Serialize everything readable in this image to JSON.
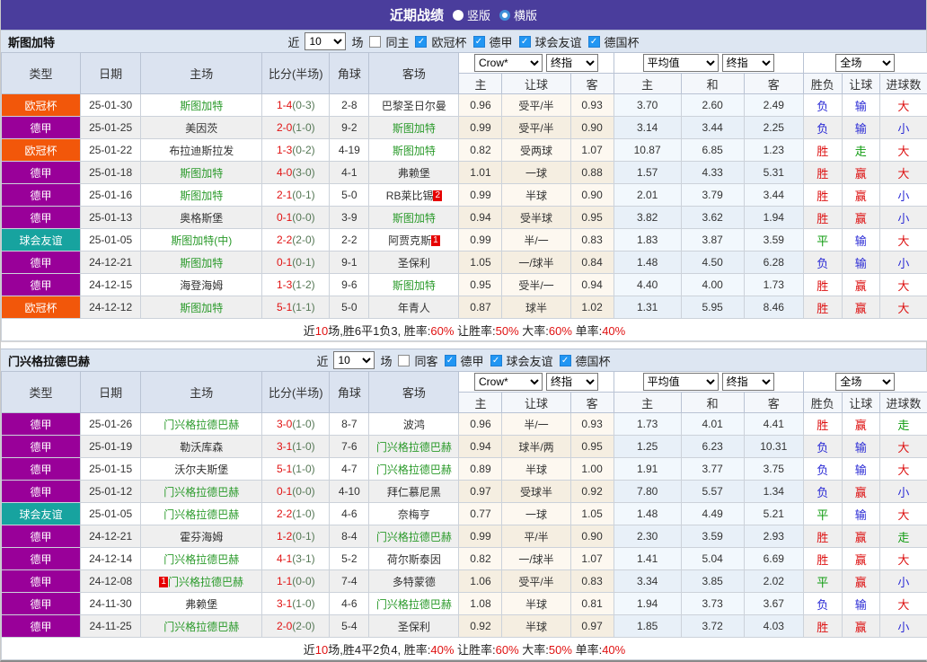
{
  "topbar": {
    "title": "近期战绩",
    "radios": [
      {
        "label": "竖版",
        "selected": true
      },
      {
        "label": "横版",
        "selected": false
      }
    ]
  },
  "table_header": {
    "type": "类型",
    "date": "日期",
    "home": "主场",
    "score": "比分(半场)",
    "corner": "角球",
    "away": "客场",
    "crow_select": "Crow*",
    "crow_final_select": "终指",
    "avg_select": "平均值",
    "avg_final_select": "终指",
    "full_select": "全场",
    "crow_sub": [
      "主",
      "让球",
      "客"
    ],
    "avg_sub": [
      "主",
      "和",
      "客"
    ],
    "result_sub": [
      "胜负",
      "让球",
      "进球数"
    ]
  },
  "type_colors": {
    "欧冠杯": "#f2570a",
    "德甲": "#990099",
    "球会友谊": "#17a39f"
  },
  "result_colors": {
    "胜": "#dd1111",
    "赢": "#dd1111",
    "大": "#dd1111",
    "平": "#0f9b0f",
    "走": "#0f9b0f",
    "负": "#2b2bd5",
    "输": "#2b2bd5",
    "小": "#2b2bd5"
  },
  "sections": [
    {
      "team": "斯图加特",
      "filter": {
        "near": "近",
        "count": "10",
        "games": "场",
        "same_label": "同主",
        "same_checked": false,
        "competitions": [
          "欧冠杯",
          "德甲",
          "球会友谊",
          "德国杯"
        ]
      },
      "rows": [
        {
          "type": "欧冠杯",
          "date": "25-01-30",
          "home": "斯图加特",
          "home_hl": true,
          "score": "1-4",
          "half": "(0-3)",
          "corner": "2-8",
          "away": "巴黎圣日尔曼",
          "away_hl": false,
          "crow": [
            "0.96",
            "受平/半",
            "0.93"
          ],
          "avg": [
            "3.70",
            "2.60",
            "2.49"
          ],
          "res": [
            "负",
            "输",
            "大"
          ]
        },
        {
          "type": "德甲",
          "date": "25-01-25",
          "home": "美因茨",
          "home_hl": false,
          "score": "2-0",
          "half": "(1-0)",
          "corner": "9-2",
          "away": "斯图加特",
          "away_hl": true,
          "crow": [
            "0.99",
            "受平/半",
            "0.90"
          ],
          "avg": [
            "3.14",
            "3.44",
            "2.25"
          ],
          "res": [
            "负",
            "输",
            "小"
          ]
        },
        {
          "type": "欧冠杯",
          "date": "25-01-22",
          "home": "布拉迪斯拉发",
          "home_hl": false,
          "score": "1-3",
          "half": "(0-2)",
          "corner": "4-19",
          "away": "斯图加特",
          "away_hl": true,
          "crow": [
            "0.82",
            "受两球",
            "1.07"
          ],
          "avg": [
            "10.87",
            "6.85",
            "1.23"
          ],
          "res": [
            "胜",
            "走",
            "大"
          ]
        },
        {
          "type": "德甲",
          "date": "25-01-18",
          "home": "斯图加特",
          "home_hl": true,
          "score": "4-0",
          "half": "(3-0)",
          "corner": "4-1",
          "away": "弗赖堡",
          "away_hl": false,
          "crow": [
            "1.01",
            "一球",
            "0.88"
          ],
          "avg": [
            "1.57",
            "4.33",
            "5.31"
          ],
          "res": [
            "胜",
            "赢",
            "大"
          ]
        },
        {
          "type": "德甲",
          "date": "25-01-16",
          "home": "斯图加特",
          "home_hl": true,
          "score": "2-1",
          "half": "(0-1)",
          "corner": "5-0",
          "away": "RB莱比锡",
          "away_hl": false,
          "away_badge": "2",
          "crow": [
            "0.99",
            "半球",
            "0.90"
          ],
          "avg": [
            "2.01",
            "3.79",
            "3.44"
          ],
          "res": [
            "胜",
            "赢",
            "小"
          ]
        },
        {
          "type": "德甲",
          "date": "25-01-13",
          "home": "奥格斯堡",
          "home_hl": false,
          "score": "0-1",
          "half": "(0-0)",
          "corner": "3-9",
          "away": "斯图加特",
          "away_hl": true,
          "crow": [
            "0.94",
            "受半球",
            "0.95"
          ],
          "avg": [
            "3.82",
            "3.62",
            "1.94"
          ],
          "res": [
            "胜",
            "赢",
            "小"
          ]
        },
        {
          "type": "球会友谊",
          "date": "25-01-05",
          "home": "斯图加特(中)",
          "home_hl": true,
          "score": "2-2",
          "half": "(2-0)",
          "corner": "2-2",
          "away": "阿贾克斯",
          "away_hl": false,
          "away_badge": "1",
          "crow": [
            "0.99",
            "半/一",
            "0.83"
          ],
          "avg": [
            "1.83",
            "3.87",
            "3.59"
          ],
          "res": [
            "平",
            "输",
            "大"
          ]
        },
        {
          "type": "德甲",
          "date": "24-12-21",
          "home": "斯图加特",
          "home_hl": true,
          "score": "0-1",
          "half": "(0-1)",
          "corner": "9-1",
          "away": "圣保利",
          "away_hl": false,
          "crow": [
            "1.05",
            "一/球半",
            "0.84"
          ],
          "avg": [
            "1.48",
            "4.50",
            "6.28"
          ],
          "res": [
            "负",
            "输",
            "小"
          ]
        },
        {
          "type": "德甲",
          "date": "24-12-15",
          "home": "海登海姆",
          "home_hl": false,
          "score": "1-3",
          "half": "(1-2)",
          "corner": "9-6",
          "away": "斯图加特",
          "away_hl": true,
          "crow": [
            "0.95",
            "受半/一",
            "0.94"
          ],
          "avg": [
            "4.40",
            "4.00",
            "1.73"
          ],
          "res": [
            "胜",
            "赢",
            "大"
          ]
        },
        {
          "type": "欧冠杯",
          "date": "24-12-12",
          "home": "斯图加特",
          "home_hl": true,
          "score": "5-1",
          "half": "(1-1)",
          "corner": "5-0",
          "away": "年青人",
          "away_hl": false,
          "crow": [
            "0.87",
            "球半",
            "1.02"
          ],
          "avg": [
            "1.31",
            "5.95",
            "8.46"
          ],
          "res": [
            "胜",
            "赢",
            "大"
          ]
        }
      ],
      "summary": [
        {
          "t": "近"
        },
        {
          "t": "10",
          "red": true
        },
        {
          "t": "场,胜6平1负3, 胜率:"
        },
        {
          "t": "60%",
          "red": true
        },
        {
          "t": " 让胜率:"
        },
        {
          "t": "50%",
          "red": true
        },
        {
          "t": " 大率:"
        },
        {
          "t": "60%",
          "red": true
        },
        {
          "t": " 单率:"
        },
        {
          "t": "40%",
          "red": true
        }
      ]
    },
    {
      "team": "门兴格拉德巴赫",
      "filter": {
        "near": "近",
        "count": "10",
        "games": "场",
        "same_label": "同客",
        "same_checked": false,
        "competitions": [
          "德甲",
          "球会友谊",
          "德国杯"
        ]
      },
      "rows": [
        {
          "type": "德甲",
          "date": "25-01-26",
          "home": "门兴格拉德巴赫",
          "home_hl": true,
          "score": "3-0",
          "half": "(1-0)",
          "corner": "8-7",
          "away": "波鸿",
          "away_hl": false,
          "crow": [
            "0.96",
            "半/一",
            "0.93"
          ],
          "avg": [
            "1.73",
            "4.01",
            "4.41"
          ],
          "res": [
            "胜",
            "赢",
            "走"
          ]
        },
        {
          "type": "德甲",
          "date": "25-01-19",
          "home": "勒沃库森",
          "home_hl": false,
          "score": "3-1",
          "half": "(1-0)",
          "corner": "7-6",
          "away": "门兴格拉德巴赫",
          "away_hl": true,
          "crow": [
            "0.94",
            "球半/两",
            "0.95"
          ],
          "avg": [
            "1.25",
            "6.23",
            "10.31"
          ],
          "res": [
            "负",
            "输",
            "大"
          ]
        },
        {
          "type": "德甲",
          "date": "25-01-15",
          "home": "沃尔夫斯堡",
          "home_hl": false,
          "score": "5-1",
          "half": "(1-0)",
          "corner": "4-7",
          "away": "门兴格拉德巴赫",
          "away_hl": true,
          "crow": [
            "0.89",
            "半球",
            "1.00"
          ],
          "avg": [
            "1.91",
            "3.77",
            "3.75"
          ],
          "res": [
            "负",
            "输",
            "大"
          ]
        },
        {
          "type": "德甲",
          "date": "25-01-12",
          "home": "门兴格拉德巴赫",
          "home_hl": true,
          "score": "0-1",
          "half": "(0-0)",
          "corner": "4-10",
          "away": "拜仁慕尼黑",
          "away_hl": false,
          "crow": [
            "0.97",
            "受球半",
            "0.92"
          ],
          "avg": [
            "7.80",
            "5.57",
            "1.34"
          ],
          "res": [
            "负",
            "赢",
            "小"
          ]
        },
        {
          "type": "球会友谊",
          "date": "25-01-05",
          "home": "门兴格拉德巴赫",
          "home_hl": true,
          "score": "2-2",
          "half": "(1-0)",
          "corner": "4-6",
          "away": "奈梅亨",
          "away_hl": false,
          "crow": [
            "0.77",
            "一球",
            "1.05"
          ],
          "avg": [
            "1.48",
            "4.49",
            "5.21"
          ],
          "res": [
            "平",
            "输",
            "大"
          ]
        },
        {
          "type": "德甲",
          "date": "24-12-21",
          "home": "霍芬海姆",
          "home_hl": false,
          "score": "1-2",
          "half": "(0-1)",
          "corner": "8-4",
          "away": "门兴格拉德巴赫",
          "away_hl": true,
          "crow": [
            "0.99",
            "平/半",
            "0.90"
          ],
          "avg": [
            "2.30",
            "3.59",
            "2.93"
          ],
          "res": [
            "胜",
            "赢",
            "走"
          ]
        },
        {
          "type": "德甲",
          "date": "24-12-14",
          "home": "门兴格拉德巴赫",
          "home_hl": true,
          "score": "4-1",
          "half": "(3-1)",
          "corner": "5-2",
          "away": "荷尔斯泰因",
          "away_hl": false,
          "crow": [
            "0.82",
            "一/球半",
            "1.07"
          ],
          "avg": [
            "1.41",
            "5.04",
            "6.69"
          ],
          "res": [
            "胜",
            "赢",
            "大"
          ]
        },
        {
          "type": "德甲",
          "date": "24-12-08",
          "home": "门兴格拉德巴赫",
          "home_hl": true,
          "home_badge": "1",
          "home_badge_pos": "before",
          "score": "1-1",
          "half": "(0-0)",
          "corner": "7-4",
          "away": "多特蒙德",
          "away_hl": false,
          "crow": [
            "1.06",
            "受平/半",
            "0.83"
          ],
          "avg": [
            "3.34",
            "3.85",
            "2.02"
          ],
          "res": [
            "平",
            "赢",
            "小"
          ]
        },
        {
          "type": "德甲",
          "date": "24-11-30",
          "home": "弗赖堡",
          "home_hl": false,
          "score": "3-1",
          "half": "(1-0)",
          "corner": "4-6",
          "away": "门兴格拉德巴赫",
          "away_hl": true,
          "crow": [
            "1.08",
            "半球",
            "0.81"
          ],
          "avg": [
            "1.94",
            "3.73",
            "3.67"
          ],
          "res": [
            "负",
            "输",
            "大"
          ]
        },
        {
          "type": "德甲",
          "date": "24-11-25",
          "home": "门兴格拉德巴赫",
          "home_hl": true,
          "score": "2-0",
          "half": "(2-0)",
          "corner": "5-4",
          "away": "圣保利",
          "away_hl": false,
          "crow": [
            "0.92",
            "半球",
            "0.97"
          ],
          "avg": [
            "1.85",
            "3.72",
            "4.03"
          ],
          "res": [
            "胜",
            "赢",
            "小"
          ]
        }
      ],
      "summary": [
        {
          "t": "近"
        },
        {
          "t": "10",
          "red": true
        },
        {
          "t": "场,胜4平2负4, 胜率:"
        },
        {
          "t": "40%",
          "red": true
        },
        {
          "t": " 让胜率:"
        },
        {
          "t": "60%",
          "red": true
        },
        {
          "t": " 大率:"
        },
        {
          "t": "50%",
          "red": true
        },
        {
          "t": " 单率:"
        },
        {
          "t": "40%",
          "red": true
        }
      ]
    }
  ]
}
